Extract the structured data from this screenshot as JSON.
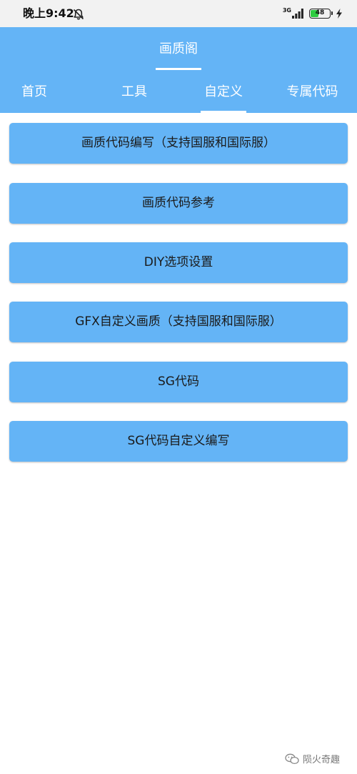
{
  "status_bar": {
    "time": "晚上9:42",
    "network": "3G",
    "battery_level": "48",
    "battery_fraction": 0.48,
    "icons": [
      "bell-muted-icon",
      "signal-icon",
      "battery-icon",
      "charging-bolt-icon"
    ]
  },
  "header": {
    "title": "画质阁"
  },
  "tabs": [
    {
      "label": "首页",
      "active": false
    },
    {
      "label": "工具",
      "active": false
    },
    {
      "label": "自定义",
      "active": true
    },
    {
      "label": "专属代码",
      "active": false
    }
  ],
  "menu": [
    {
      "label": "画质代码编写（支持国服和国际服）"
    },
    {
      "label": "画质代码参考"
    },
    {
      "label": "DIY选项设置"
    },
    {
      "label": "GFX自定义画质（支持国服和国际服）"
    },
    {
      "label": "SG代码"
    },
    {
      "label": "SG代码自定义编写"
    }
  ],
  "watermark": {
    "text": "陨火奇趣",
    "icon": "wechat-icon"
  },
  "colors": {
    "accent": "#64b4f6",
    "status_bar_bg": "#f2f2f2",
    "battery_green": "#2ecc40",
    "page_bg": "#ffffff"
  }
}
